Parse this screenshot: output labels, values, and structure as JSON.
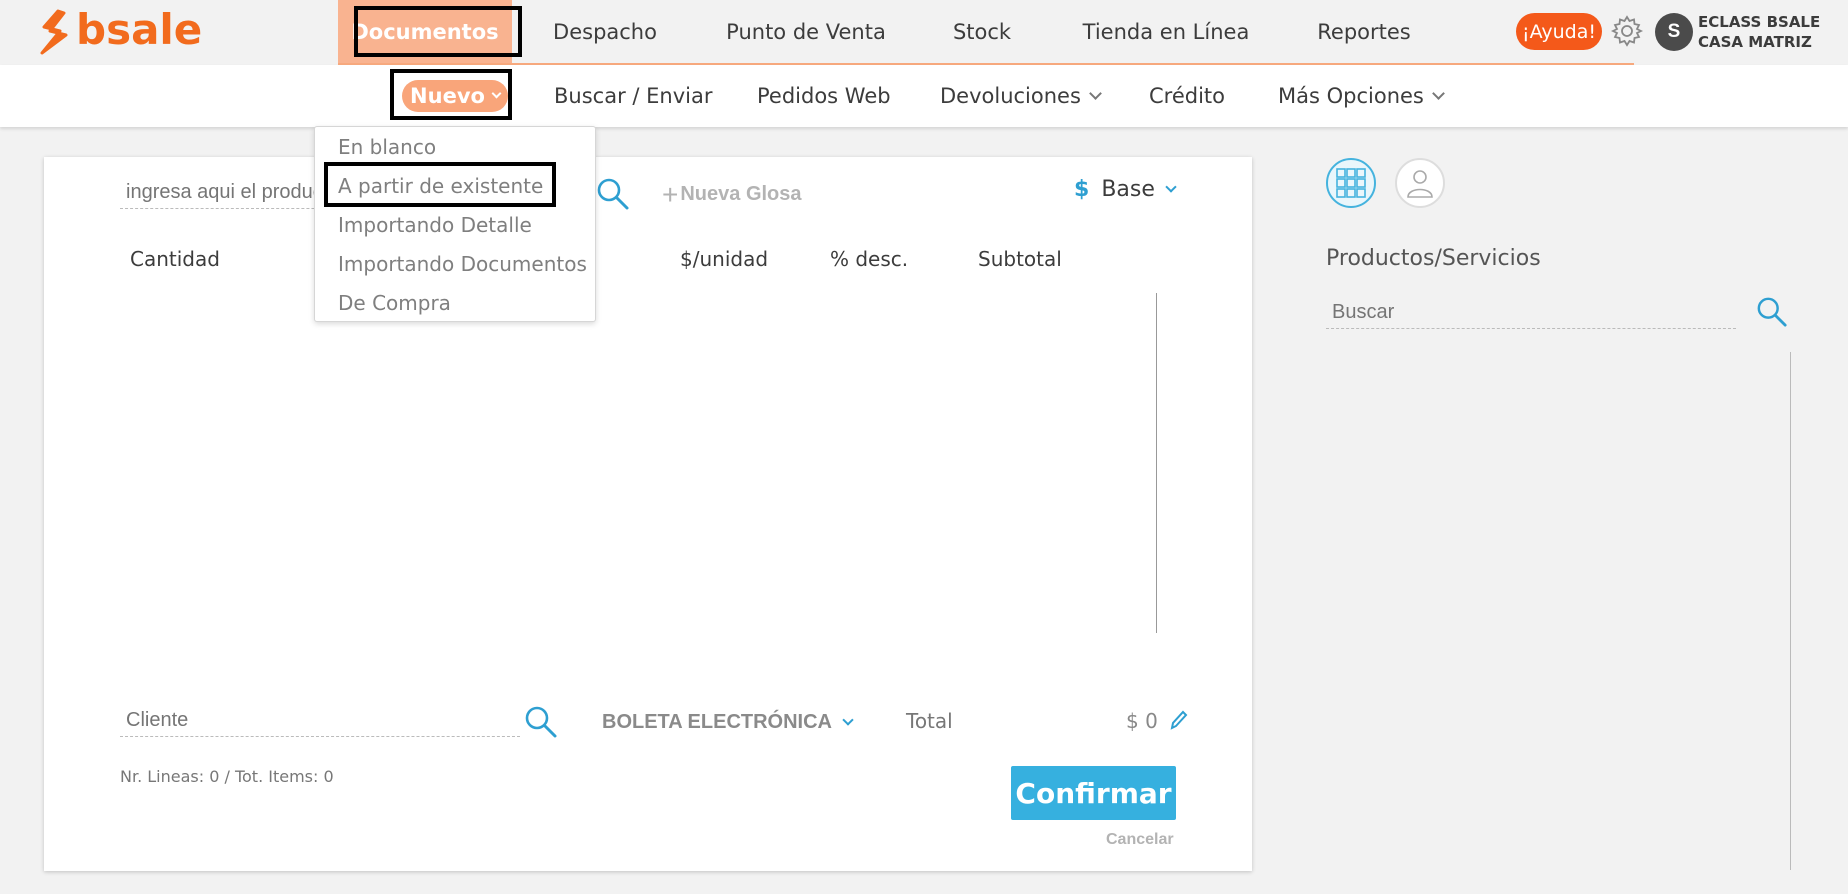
{
  "brand": {
    "name": "bsale",
    "color": "#f26b1d"
  },
  "main_nav": [
    {
      "label": "Documentos",
      "active": true
    },
    {
      "label": "Despacho"
    },
    {
      "label": "Punto de Venta"
    },
    {
      "label": "Stock"
    },
    {
      "label": "Tienda en Línea"
    },
    {
      "label": "Reportes"
    }
  ],
  "header": {
    "help_label": "¡Ayuda!",
    "avatar_initial": "S",
    "account_line1": "ECLASS BSALE",
    "account_line2": "CASA MATRIZ"
  },
  "sub_nav": {
    "nuevo": "Nuevo",
    "buscar": "Buscar / Enviar",
    "pedidos": "Pedidos Web",
    "devoluciones": "Devoluciones",
    "credito": "Crédito",
    "mas": "Más Opciones"
  },
  "nuevo_menu": [
    "En blanco",
    "A partir de existente",
    "Importando Detalle",
    "Importando Documentos",
    "De Compra"
  ],
  "document": {
    "product_placeholder": "ingresa aqui el producto",
    "new_glosa": "Nueva Glosa",
    "currency_symbol": "$",
    "currency": "Base",
    "columns": {
      "cantidad": "Cantidad",
      "unit": "$/unidad",
      "desc": "% desc.",
      "subtotal": "Subtotal"
    },
    "client_placeholder": "Cliente",
    "doc_type": "BOLETA ELECTRÓNICA",
    "total_label": "Total",
    "total_value": "$ 0",
    "lines_info": "Nr. Lineas: 0 / Tot. Items: 0",
    "confirm": "Confirmar",
    "cancel": "Cancelar"
  },
  "side": {
    "title": "Productos/Servicios",
    "search_placeholder": "Buscar"
  },
  "colors": {
    "accent_orange": "#f9b390",
    "help_red": "#f4591a",
    "confirm_blue": "#36b0df",
    "icon_blue": "#2e9fd1"
  }
}
